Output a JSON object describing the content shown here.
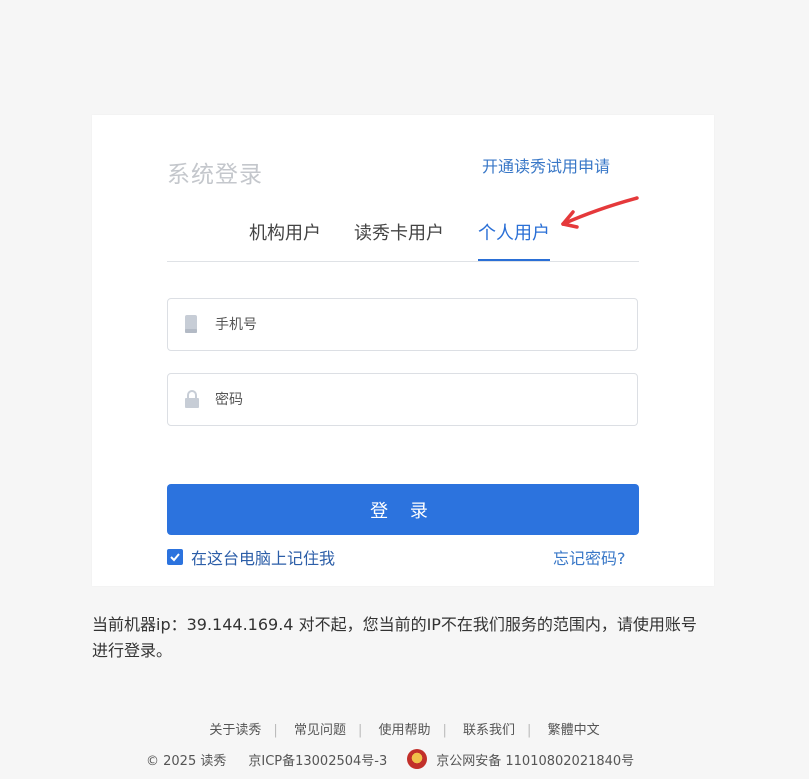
{
  "card": {
    "title": "系统登录",
    "trial_link": "开通读秀试用申请",
    "tabs": [
      {
        "label": "机构用户",
        "active": false
      },
      {
        "label": "读秀卡用户",
        "active": false
      },
      {
        "label": "个人用户",
        "active": true
      }
    ],
    "phone": {
      "placeholder": "手机号",
      "icon": "phone-icon"
    },
    "password": {
      "placeholder": "密码",
      "icon": "lock-icon"
    },
    "login_label": "登 录",
    "remember_label": "在这台电脑上记住我",
    "remember_checked": true,
    "forgot_label": "忘记密码?"
  },
  "notice": "当前机器ip：39.144.169.4  对不起，您当前的IP不在我们服务的范围内，请使用账号进行登录。",
  "footer": {
    "links": [
      "关于读秀",
      "常见问题",
      "使用帮助",
      "联系我们",
      "繁體中文"
    ],
    "copyright": "© 2025 读秀",
    "icp": "京ICP备13002504号-3",
    "police": "京公网安备 11010802021840号"
  },
  "colors": {
    "accent": "#2c73de",
    "annotation_arrow": "#e5393b"
  }
}
